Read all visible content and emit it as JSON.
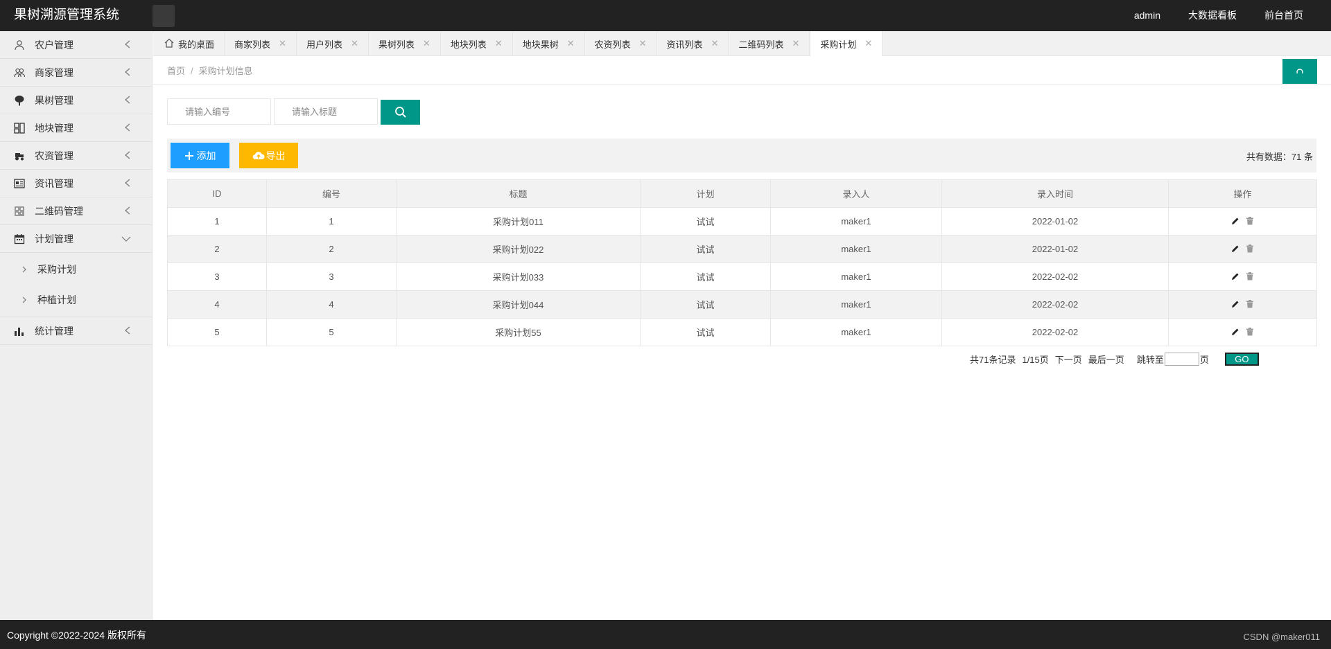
{
  "header": {
    "title": "果树溯源管理系统",
    "nav": [
      "admin",
      "大数据看板",
      "前台首页"
    ]
  },
  "sidebar": {
    "items": [
      {
        "label": "农户管理",
        "icon": "user-icon"
      },
      {
        "label": "商家管理",
        "icon": "users-icon"
      },
      {
        "label": "果树管理",
        "icon": "tree-icon"
      },
      {
        "label": "地块管理",
        "icon": "grid-icon"
      },
      {
        "label": "农资管理",
        "icon": "tractor-icon"
      },
      {
        "label": "资讯管理",
        "icon": "news-icon"
      },
      {
        "label": "二维码管理",
        "icon": "qrcode-icon"
      },
      {
        "label": "计划管理",
        "icon": "calendar-icon"
      },
      {
        "label": "统计管理",
        "icon": "bar-chart-icon"
      }
    ],
    "submenu": [
      "采购计划",
      "种植计划"
    ]
  },
  "tabs": {
    "home": "我的桌面",
    "items": [
      "商家列表",
      "用户列表",
      "果树列表",
      "地块列表",
      "地块果树",
      "农资列表",
      "资讯列表",
      "二维码列表"
    ],
    "active": "采购计划"
  },
  "breadcrumb": {
    "home": "首页",
    "sep": "/",
    "current": "采购计划信息"
  },
  "search": {
    "no_placeholder": "请输入编号",
    "title_placeholder": "请输入标题"
  },
  "toolbar": {
    "add_label": "添加",
    "export_label": "导出",
    "total_text": "共有数据：71 条"
  },
  "table": {
    "headers": [
      "ID",
      "编号",
      "标题",
      "计划",
      "录入人",
      "录入时间",
      "操作"
    ],
    "rows": [
      [
        "1",
        "1",
        "采购计划011",
        "试试",
        "maker1",
        "2022-01-02"
      ],
      [
        "2",
        "2",
        "采购计划022",
        "试试",
        "maker1",
        "2022-01-02"
      ],
      [
        "3",
        "3",
        "采购计划033",
        "试试",
        "maker1",
        "2022-02-02"
      ],
      [
        "4",
        "4",
        "采购计划044",
        "试试",
        "maker1",
        "2022-02-02"
      ],
      [
        "5",
        "5",
        "采购计划55",
        "试试",
        "maker1",
        "2022-02-02"
      ]
    ]
  },
  "pager": {
    "records": "共71条记录",
    "page": "1/15页",
    "next": "下一页",
    "last": "最后一页",
    "jump_label": "跳转至",
    "page_unit": "页",
    "go": "GO"
  },
  "footer": {
    "copyright": "Copyright ©2022-2024 版权所有",
    "watermark": "CSDN @maker011"
  },
  "colors": {
    "accent": "#009688",
    "add": "#1E9FFF",
    "export": "#FFB800",
    "header_bg": "#222222"
  }
}
